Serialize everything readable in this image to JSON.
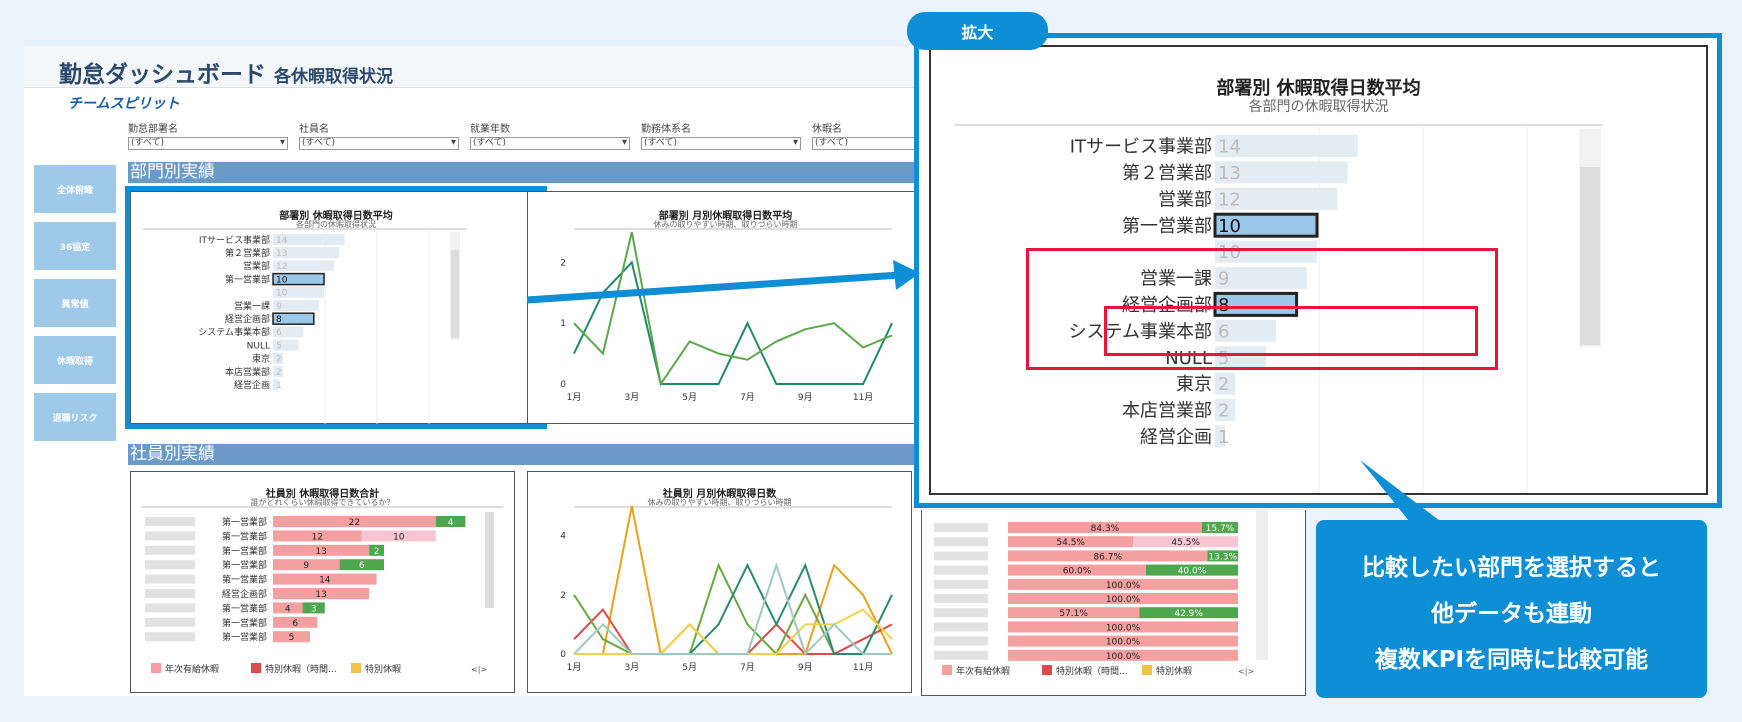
{
  "header": {
    "title": "勤怠ダッシュボード",
    "subtitle": "各休暇取得状況",
    "brand": "チームスピリット"
  },
  "filters": [
    {
      "label": "勤怠部署名",
      "value": "(すべて)"
    },
    {
      "label": "社員名",
      "value": "(すべて)"
    },
    {
      "label": "就業年数",
      "value": "(すべて)"
    },
    {
      "label": "勤務体系名",
      "value": "(すべて)"
    },
    {
      "label": "休暇名",
      "value": "(すべて)"
    }
  ],
  "sidebar": {
    "items": [
      {
        "label": "全体俯瞰"
      },
      {
        "label": "36協定"
      },
      {
        "label": "異常値"
      },
      {
        "label": "休暇取得"
      },
      {
        "label": "退職リスク"
      }
    ]
  },
  "sections": {
    "dept": "部門別実績",
    "emp": "社員別実績"
  },
  "panels": {
    "dept_avg": {
      "title": "部署別 休暇取得日数平均",
      "subtitle": "各部門の休暇取得状況"
    },
    "dept_monthly": {
      "title": "部署別 月別休暇取得日数平均",
      "subtitle": "休みの取りやすい時期、取りづらい時期"
    },
    "emp_total": {
      "title": "社員別 休暇取得日数合計",
      "subtitle": "誰がどれくらい休暇取得できているか？"
    },
    "emp_monthly": {
      "title": "社員別 月別休暇取得日数",
      "subtitle": "休みの取りやすい時期、取りづらい時期"
    }
  },
  "zoom_tab": "拡大",
  "callout": {
    "line1": "比較したい部門を選択すると",
    "line2": "他データも連動",
    "line3": "複数KPIを同時に比較可能"
  },
  "legend": {
    "annual": "年次有給休暇",
    "special_time": "特別休暇（時間...",
    "special": "特別休暇",
    "nav": "<|>"
  },
  "colors": {
    "accent": "#0e8ed4",
    "highlight": "#e8143c",
    "bar_light": "#e3ebf3",
    "bar_selected": "#9dc7e8",
    "pink": "#f4a0a0",
    "green": "#4ea64e",
    "pale_pink": "#f7c6d4"
  },
  "chart_data": [
    {
      "type": "bar",
      "title": "部署別 休暇取得日数平均",
      "subtitle": "各部門の休暇取得状況",
      "orientation": "horizontal",
      "categories": [
        "ITサービス事業部",
        "第２営業部",
        "営業部",
        "第一営業部",
        "",
        "営業一課",
        "経営企画部",
        "システム事業本部",
        "NULL",
        "東京",
        "本店営業部",
        "経営企画"
      ],
      "values": [
        14,
        13,
        12,
        10,
        10,
        9,
        8,
        6,
        5,
        2,
        2,
        1
      ],
      "selected": [
        "第一営業部",
        "経営企画部"
      ]
    },
    {
      "type": "line",
      "title": "部署別 月別休暇取得日数平均",
      "subtitle": "休みの取りやすい時期、取りづらい時期",
      "x": [
        "1月",
        "2月",
        "3月",
        "4月",
        "5月",
        "6月",
        "7月",
        "8月",
        "9月",
        "10月",
        "11月",
        "12月"
      ],
      "xticks": [
        "1月",
        "3月",
        "5月",
        "7月",
        "9月",
        "11月"
      ],
      "yticks": [
        0,
        1,
        2
      ],
      "ylim": [
        0,
        2.5
      ],
      "series": [
        {
          "color": "#1f8a6c",
          "values": [
            0.5,
            1.5,
            2.0,
            0,
            0,
            0,
            1.0,
            0,
            0,
            0,
            0,
            1.0
          ]
        },
        {
          "color": "#5aa84a",
          "values": [
            1.0,
            0.5,
            2.5,
            0,
            0.7,
            0.5,
            0.4,
            0.7,
            0.9,
            1.0,
            0.6,
            0.8
          ]
        }
      ]
    },
    {
      "type": "bar",
      "title": "社員別 休暇取得日数合計",
      "subtitle": "誰がどれくらい休暇取得できているか？",
      "stacked": true,
      "orientation": "horizontal",
      "categories": [
        "第一営業部",
        "第一営業部",
        "第一営業部",
        "第一営業部",
        "第一営業部",
        "経営企画部",
        "第一営業部",
        "第一営業部",
        "第一営業部"
      ],
      "series": [
        {
          "name": "年次有給休暇",
          "values": [
            22,
            12,
            13,
            9,
            14,
            13,
            4,
            6,
            5
          ]
        },
        {
          "name": "特別休暇（時間...",
          "values": [
            0,
            10,
            0,
            0,
            0,
            0,
            0,
            0,
            0
          ]
        },
        {
          "name": "特別休暇",
          "values": [
            4,
            0,
            2,
            6,
            0,
            0,
            3,
            0,
            0
          ]
        }
      ]
    },
    {
      "type": "line",
      "title": "社員別 月別休暇取得日数",
      "subtitle": "休みの取りやすい時期、取りづらい時期",
      "x": [
        "1月",
        "2月",
        "3月",
        "4月",
        "5月",
        "6月",
        "7月",
        "8月",
        "9月",
        "10月",
        "11月",
        "12月"
      ],
      "xticks": [
        "1月",
        "3月",
        "5月",
        "7月",
        "9月",
        "11月"
      ],
      "yticks": [
        0,
        2,
        4
      ],
      "ylim": [
        0,
        5
      ],
      "series": [
        {
          "color": "#e8a21a",
          "values": [
            0,
            0,
            5,
            0,
            0,
            0,
            0,
            0,
            0,
            3,
            2,
            0
          ]
        },
        {
          "color": "#d94a4a",
          "values": [
            0.5,
            1.5,
            0,
            0,
            1.0,
            0,
            0,
            1.0,
            0,
            0,
            0.5,
            1.0
          ]
        },
        {
          "color": "#6aa840",
          "values": [
            2.0,
            0.5,
            0,
            0,
            0,
            3.0,
            1.0,
            0,
            2.0,
            0,
            0,
            0
          ]
        },
        {
          "color": "#2a8a70",
          "values": [
            0,
            0,
            0,
            0,
            0,
            1.0,
            3.0,
            1.0,
            3.0,
            0,
            0,
            2.0
          ]
        },
        {
          "color": "#f0d24a",
          "values": [
            0,
            0,
            0,
            0,
            1.0,
            0,
            0,
            0,
            1.0,
            1.0,
            1.5,
            0.5
          ]
        },
        {
          "color": "#9fc9c0",
          "values": [
            0,
            1.0,
            0,
            0,
            0,
            0,
            0,
            3.0,
            0,
            1.0,
            0,
            0
          ]
        }
      ]
    },
    {
      "type": "bar",
      "stacked": true,
      "orientation": "horizontal",
      "percent": true,
      "series": [
        {
          "name": "年次有給休暇",
          "values": [
            84.3,
            54.5,
            86.7,
            60.0,
            100.0,
            100.0,
            57.1,
            100.0,
            100.0,
            100.0
          ]
        },
        {
          "name": "特別休暇（時間...",
          "values": [
            0,
            45.5,
            0,
            0,
            0,
            0,
            0,
            0,
            0,
            0
          ]
        },
        {
          "name": "特別休暇",
          "values": [
            15.7,
            0,
            13.3,
            40.0,
            0,
            0,
            42.9,
            0,
            0,
            0
          ]
        }
      ],
      "labels": [
        [
          "84.3%",
          "15.7%"
        ],
        [
          "54.5%",
          "45.5%"
        ],
        [
          "86.7%",
          "13.3%"
        ],
        [
          "60.0%",
          "40.0%"
        ],
        [
          "100.0%"
        ],
        [
          "100.0%"
        ],
        [
          "57.1%",
          "42.9%"
        ],
        [
          "100.0%"
        ],
        [
          "100.0%"
        ],
        [
          "100.0%"
        ]
      ]
    }
  ]
}
